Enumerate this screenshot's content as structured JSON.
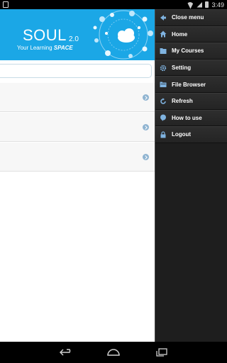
{
  "status_bar": {
    "time": "3:49"
  },
  "banner": {
    "brand": "SOUL",
    "version": "2.0",
    "tagline_prefix": "Your Learning ",
    "tagline_emphasis": "SPACE"
  },
  "search": {
    "placeholder": "",
    "value": ""
  },
  "list": {
    "items": [
      {
        "text": ""
      },
      {
        "text": ""
      },
      {
        "text": ""
      }
    ]
  },
  "menu": {
    "items": [
      {
        "label": "Close menu",
        "icon": "arrow-left-icon"
      },
      {
        "label": "Home",
        "icon": "home-icon"
      },
      {
        "label": "My Courses",
        "icon": "folder-icon"
      },
      {
        "label": "Setting",
        "icon": "gear-icon"
      },
      {
        "label": "File Browser",
        "icon": "file-folder-icon"
      },
      {
        "label": "Refresh",
        "icon": "refresh-icon"
      },
      {
        "label": "How to use",
        "icon": "help-bubble-icon"
      },
      {
        "label": "Logout",
        "icon": "lock-icon"
      }
    ]
  },
  "colors": {
    "banner": "#1ba7e6",
    "menu_bg": "#1f1f1f",
    "menu_icon": "#7fb3e0",
    "chevron": "#8fb4d1"
  }
}
